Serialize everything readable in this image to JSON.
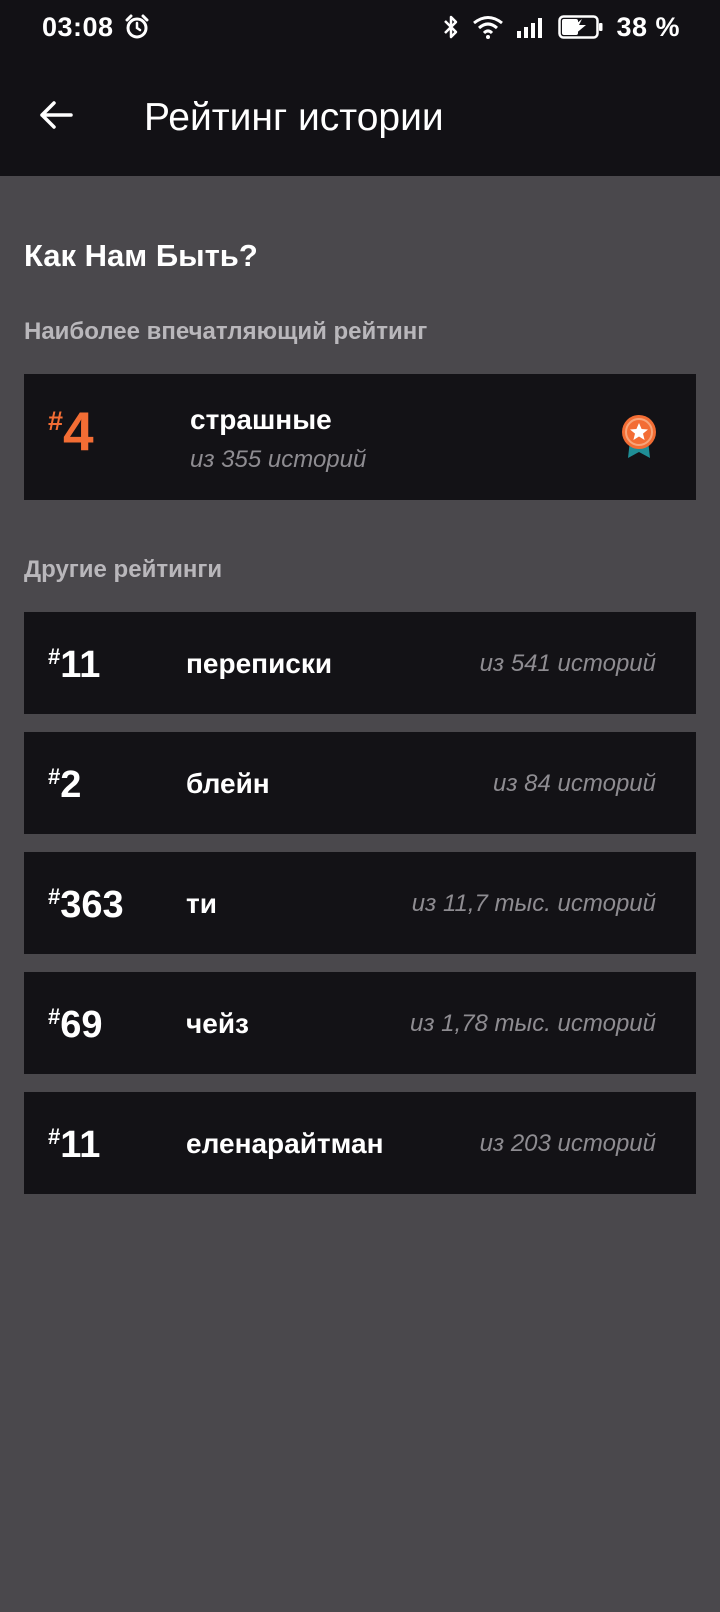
{
  "status_bar": {
    "time": "03:08",
    "battery": "38 %",
    "icons": [
      "alarm-icon",
      "bluetooth-icon",
      "wifi-icon",
      "signal-icon",
      "battery-charging-icon"
    ]
  },
  "app_bar": {
    "title": "Рейтинг истории",
    "back_icon": "arrow-back-icon"
  },
  "story": {
    "title": "Как Нам Быть?"
  },
  "most_impressive": {
    "label": "Наиболее впечатляющий рейтинг",
    "hash": "#",
    "rank": "4",
    "tag": "страшные",
    "count": "из 355 историй",
    "badge_icon": "medal-star-icon",
    "accent_color": "#f36d34"
  },
  "other": {
    "label": "Другие рейтинги",
    "items": [
      {
        "hash": "#",
        "rank": "11",
        "tag": "переписки",
        "count": "из 541 историй"
      },
      {
        "hash": "#",
        "rank": "2",
        "tag": "блейн",
        "count": "из 84 историй"
      },
      {
        "hash": "#",
        "rank": "363",
        "tag": "ти",
        "count": "из 11,7 тыс. историй"
      },
      {
        "hash": "#",
        "rank": "69",
        "tag": "чейз",
        "count": "из 1,78 тыс. историй"
      },
      {
        "hash": "#",
        "rank": "11",
        "tag": "еленарайтман",
        "count": "из 203 историй"
      }
    ]
  }
}
